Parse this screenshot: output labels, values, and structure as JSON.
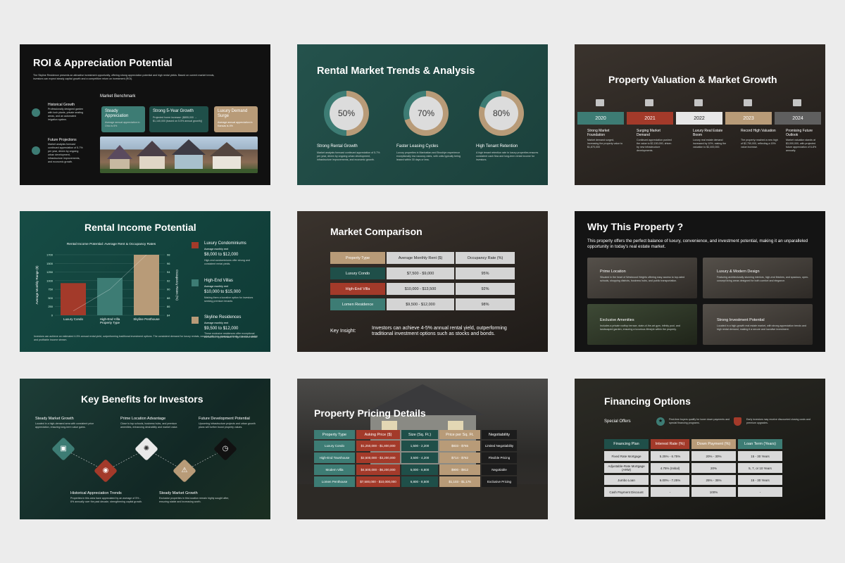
{
  "colors": {
    "teal": "#3d7c74",
    "rust": "#a33a2a",
    "tan": "#b89b78",
    "gray": "#d4d4d4",
    "dark": "#111111"
  },
  "s1": {
    "title": "ROI & Appreciation Potential",
    "intro": "The Skyline Residence presents an attractive investment opportunity, offering strong appreciation potential and high rental yields. Based on current market trends, investors can expect steady capital growth and a competitive return on investment (ROI).",
    "benchmark_title": "Market Benchmark",
    "items": [
      {
        "icon": "globe-icon",
        "title": "Historical Growth",
        "text": "Professionally designed garden with lush plants, private seating areas, and an automated irrigation system."
      },
      {
        "icon": "chart-icon",
        "title": "Future Projections",
        "text": "Market analysts forecast continued appreciation of 5-7% per year, driven by ongoing urban development, infrastructure improvements, and economic growth."
      }
    ],
    "cards": [
      {
        "title": "Steady Appreciation",
        "text": "Average annual appreciation in Ohio is 6%"
      },
      {
        "title": "Strong 5-Year Growth",
        "text": "Projected home increase: ($855,000 → $1,140,000 (based on 5.5% annual growth))"
      },
      {
        "title": "Luxury Demand Surge",
        "text": "Average annual appreciation in Kansas is 4%"
      }
    ]
  },
  "s2": {
    "title": "Rental Market Trends & Analysis",
    "rings": [
      {
        "value": 50,
        "label": "50%",
        "title": "Strong Rental Growth",
        "text": "Market analysts forecast continued appreciation of 5-7% per year, driven by ongoing urban development, infrastructure improvements, and economic growth."
      },
      {
        "value": 70,
        "label": "70%",
        "title": "Faster Leasing Cycles",
        "text": "Luxury properties in Manhattan and Brooklyn experience exceptionally low vacancy rates, with units typically being leased within 30 days or less."
      },
      {
        "value": 80,
        "label": "80%",
        "title": "High Tenant Retention",
        "text": "A high tenant retention rate in luxury properties ensures consistent cash flow and long-term rental income for investors."
      }
    ]
  },
  "s3": {
    "title": "Property Valuation & Market Growth",
    "years": [
      {
        "year": "2020",
        "icon": "building-icon",
        "title": "Strong Market Foundation",
        "text": "Market demand surged, increasing the property value to $1,870,000"
      },
      {
        "year": "2021",
        "icon": "briefcase-icon",
        "title": "Surging Market Demand",
        "text": "Continued appreciation pushed the value to $2,150,000, driven by new infrastructure developments."
      },
      {
        "year": "2022",
        "icon": "location-icon",
        "title": "Luxury Real Estate Boom",
        "text": "Luxury real estate demand increased by 10%, raising the valuation to $2,400,000."
      },
      {
        "year": "2023",
        "icon": "money-icon",
        "title": "Record High Valuation",
        "text": "The property reached a new high of $2,750,000, reflecting a 15% value increase."
      },
      {
        "year": "2024",
        "icon": "case-icon",
        "title": "Promising Future Outlook",
        "text": "Market valuation stands at $3,000,000, with projected future appreciation of 6-8% annually."
      }
    ]
  },
  "s4": {
    "title": "Rental Income Potential",
    "footer": "Investors can achieve an estimated 4-5% annual rental yield, outperforming traditional investment options. The consistent demand for luxury rentals, coupled with low vacancy periods, ensures a stable and profitable income stream.",
    "side": [
      {
        "icon": "house-icon",
        "title": "Luxury Condominiums",
        "sub": "Average monthly rent",
        "range": "$8,000 to $12,000",
        "text": "High-end condominiums offer strong and consistent rental yields."
      },
      {
        "icon": "office-icon",
        "title": "High-End Villas",
        "sub": "Average monthly rent",
        "range": "$10,000 to $15,000",
        "text": "Making them a lucrative option for investors seeking premium tenants"
      },
      {
        "icon": "city-icon",
        "title": "Skyline Residences",
        "sub": "Average monthly rent",
        "range": "$9,500 to $12,000",
        "text": "These exclusive residences offer exceptional investment opportunities in high-demand areas."
      }
    ]
  },
  "chart_data": {
    "type": "bar",
    "title": "Rental Income Potential: Average Rent & Occupancy Rates",
    "categories": [
      "Luxury Condo",
      "High-End Villa Property Type",
      "Skyline Penthouse"
    ],
    "series": [
      {
        "name": "Average Monthly Range ($)",
        "values": [
          9300,
          10800,
          17500
        ]
      },
      {
        "name": "Occupancy Rates (%)",
        "values": [
          85,
          90,
          98
        ]
      }
    ],
    "ylabel": "Average Monthly Range ($)",
    "y2label": "Occupancy Rates (%)",
    "ylim": [
      0,
      17500
    ],
    "yticks": [
      "1700",
      "1500",
      "1250",
      "1000",
      "750",
      "500",
      "250",
      "0"
    ],
    "y2ticks": [
      "98",
      "96",
      "94",
      "92",
      "90",
      "88",
      "86",
      "84"
    ],
    "colors": [
      "#a33a2a",
      "#3d7c74",
      "#b89b78"
    ]
  },
  "s5": {
    "title": "Market Comparison",
    "headers": [
      "Property Type",
      "Average Monthly Rent ($)",
      "Occupancy Rate (%)"
    ],
    "rows": [
      {
        "name": "Luxury Condo",
        "rent": "$7,500 - $9,000",
        "occ": "95%"
      },
      {
        "name": "High-End Villa",
        "rent": "$10,000 - $13,500",
        "occ": "92%"
      },
      {
        "name": "Lomen Residence",
        "rent": "$9,500 - $12,000",
        "occ": "98%"
      }
    ],
    "insight_label": "Key Insight:",
    "insight": "Investors can achieve 4-5% annual rental yield, outperforming traditional investment options such as stocks and bonds."
  },
  "s6": {
    "title": "Why This Property ?",
    "intro": "This property offers the perfect balance of luxury, convenience, and investment potential, making it an unparalleled opportunity in today's real estate market.",
    "cards": [
      {
        "title": "Prime Location",
        "text": "Situated in the heart of Westwood Heights offering easy access to top-rated schools, shopping districts, business hubs, and public transportation."
      },
      {
        "title": "Luxury & Modern Design",
        "text": "Featuring architecturally stunning interiors, high-end finishes, and spacious, open-concept living areas designed for both comfort and elegance."
      },
      {
        "title": "Exclusive Amenities",
        "text": "Includes a private rooftop terrace, state-of-the-art gym, infinity pool, and landscaped garden, ensuring a luxurious lifestyle within the property."
      },
      {
        "title": "Strong Investment Potential",
        "text": "Located in a high-growth real estate market, with strong appreciation trends and high rental demand, making it a secure and lucrative investment."
      }
    ]
  },
  "s7": {
    "title": "Key Benefits for Investors",
    "top": [
      {
        "title": "Steady Market Growth",
        "text": "Located in a high-demand area with consistent price appreciation, ensuring long-term value gains."
      },
      {
        "title": "Prime Location Advantage",
        "text": "Close to top schools, business hubs, and premium amenities, enhancing desirability and market value."
      },
      {
        "title": "Future Development Potential",
        "text": "Upcoming infrastructure projects and urban growth plans will further boost property values."
      }
    ],
    "bottom": [
      {
        "title": "Historical Appreciation Trends",
        "text": "Properties in this area have appreciated by an average of 5% - 6% annually over the past decade, strengthening capital growth."
      },
      {
        "title": "Steady Market Growth",
        "text": "Exclusive properties in this location remain highly sought after, ensuring stable and increasing worth."
      }
    ]
  },
  "s8": {
    "title": "Property Pricing Details",
    "headers": [
      "Property Type",
      "Asking Price ($)",
      "Size (Sq. Ft.)",
      "Price per Sq. Ft.",
      "Negotiability"
    ],
    "rows": [
      [
        "Luxury Condo",
        "$1,250,000 - $1,800,000",
        "1,500 - 2,200",
        "$833 - $765",
        "Limited Negotiability"
      ],
      [
        "High-End Townhouse",
        "$2,500,000 - $3,200,000",
        "3,500 - 4,200",
        "$714 - $762",
        "Flexible Pricing"
      ],
      [
        "Modern Villa",
        "$4,500,000 - $6,200,000",
        "5,000 - 6,800",
        "$900 - $912",
        "Negotiable"
      ],
      [
        "Lomen Penthouse",
        "$7,500,000 - $10,000,000",
        "6,800 - 8,500",
        "$1,103 - $1,176",
        "Exclusive Pricing"
      ]
    ]
  },
  "s9": {
    "title": "Financing Options",
    "offers_label": "Special Offers",
    "offers": [
      {
        "icon": "star-icon",
        "text": "First-time buyers qualify for lower down payments and special financing programs."
      },
      {
        "icon": "shield-icon",
        "text": "Early investors may receive discounted closing costs and premium upgrades."
      }
    ],
    "headers": [
      "Financing Plan",
      "Interest Rate (%)",
      "Down Payment (%)",
      "Loan Term (Years)"
    ],
    "rows": [
      [
        "Fixed Rate Mortgage",
        "5.25% - 6.75%",
        "20% - 30%",
        "15 - 30 Years"
      ],
      [
        "Adjustable-Rate Mortgage (ARM)",
        "4.75% (Initial)",
        "20%",
        "5, 7, or 10 Years"
      ],
      [
        "Jumbo Loan",
        "6.00% - 7.25%",
        "25% - 35%",
        "15 - 30 Years"
      ],
      [
        "Cash Payment Discount",
        "-",
        "100%",
        "-"
      ]
    ]
  }
}
